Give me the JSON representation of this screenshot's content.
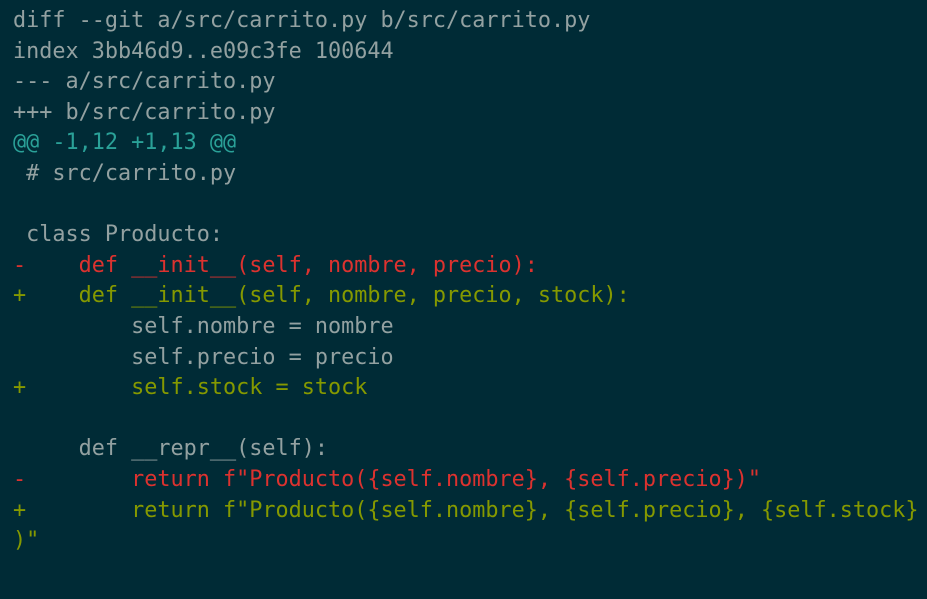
{
  "colors": {
    "background": "#002b36",
    "context": "#93a1a1",
    "hunk_header": "#2aa198",
    "deleted": "#dc322f",
    "added": "#859900"
  },
  "diff": {
    "header": {
      "command": "diff --git a/src/carrito.py b/src/carrito.py",
      "index": "index 3bb46d9..e09c3fe 100644",
      "old_file": "--- a/src/carrito.py",
      "new_file": "+++ b/src/carrito.py"
    },
    "hunk": "@@ -1,12 +1,13 @@",
    "lines": [
      {
        "type": "ctx",
        "text": " # src/carrito.py"
      },
      {
        "type": "ctx",
        "text": ""
      },
      {
        "type": "ctx",
        "text": " class Producto:"
      },
      {
        "type": "del",
        "text": "-    def __init__(self, nombre, precio):"
      },
      {
        "type": "add",
        "text": "+    def __init__(self, nombre, precio, stock):"
      },
      {
        "type": "ctx",
        "text": "         self.nombre = nombre"
      },
      {
        "type": "ctx",
        "text": "         self.precio = precio"
      },
      {
        "type": "add",
        "text": "+        self.stock = stock"
      },
      {
        "type": "ctx",
        "text": ""
      },
      {
        "type": "ctx",
        "text": "     def __repr__(self):"
      },
      {
        "type": "del",
        "text": "-        return f\"Producto({self.nombre}, {self.precio})\""
      },
      {
        "type": "add",
        "text": "+        return f\"Producto({self.nombre}, {self.precio}, {self.stock}"
      },
      {
        "type": "add",
        "text": ")\""
      }
    ]
  }
}
